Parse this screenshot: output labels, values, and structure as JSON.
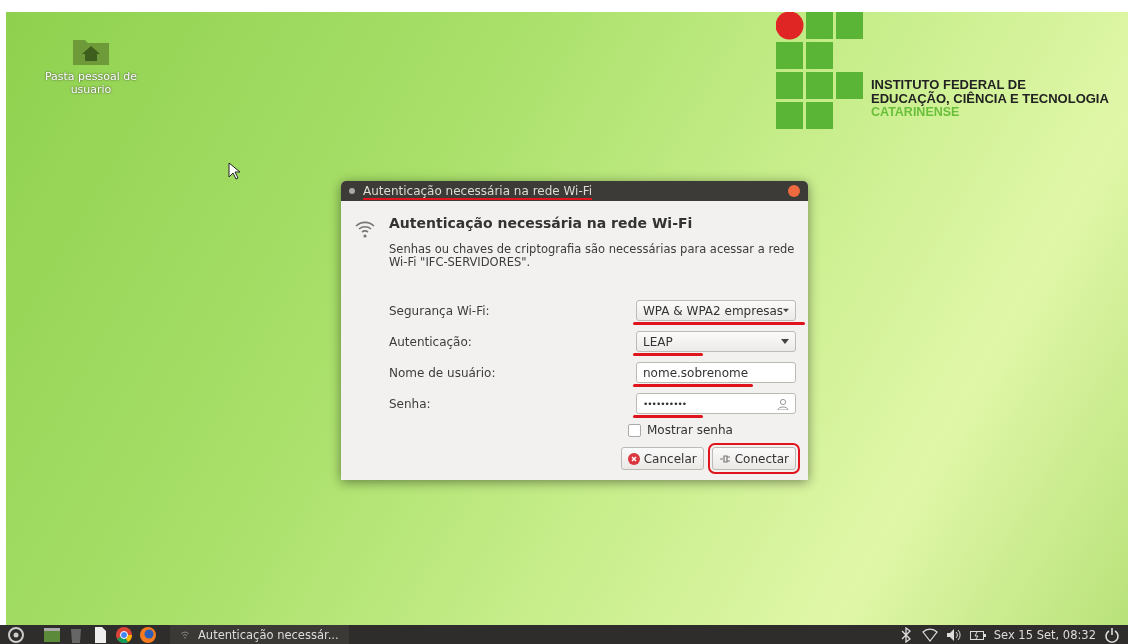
{
  "desktop_icons": [
    {
      "label": "Pasta pessoal de usuario"
    }
  ],
  "logo": {
    "lines": [
      "INSTITUTO FEDERAL DE",
      "EDUCAÇÃO, CIÊNCIA E TECNOLOGIA"
    ],
    "subtitle": "CATARINENSE"
  },
  "dialog": {
    "title": "Autenticação necessária na rede Wi-Fi",
    "title_underlined": true,
    "heading": "Autenticação necessária na rede Wi-Fi",
    "message": "Senhas ou chaves de criptografia são necessárias para acessar a rede Wi-Fi \"IFC-SERVIDORES\".",
    "fields": [
      {
        "kind": "dropdown",
        "label": "Segurança Wi-Fi:",
        "value": "WPA & WPA2 empresas",
        "underlined": true
      },
      {
        "kind": "dropdown",
        "label": "Autenticação:",
        "value": "LEAP",
        "underlined": true
      },
      {
        "kind": "text",
        "label": "Nome de usuário:",
        "value": "nome.sobrenome",
        "underlined": true
      },
      {
        "kind": "password",
        "label": "Senha:",
        "value": "••••••••••",
        "underlined": true
      }
    ],
    "show_password": {
      "label": "Mostrar senha",
      "checked": false
    },
    "buttons": [
      {
        "kind": "cancel",
        "label": "Cancelar",
        "highlighted": false
      },
      {
        "kind": "connect",
        "label": "Conectar",
        "highlighted": true
      }
    ]
  },
  "taskbar": {
    "window_button": "Autenticação necessár...",
    "clock": "Sex 15 Set, 08:32"
  }
}
